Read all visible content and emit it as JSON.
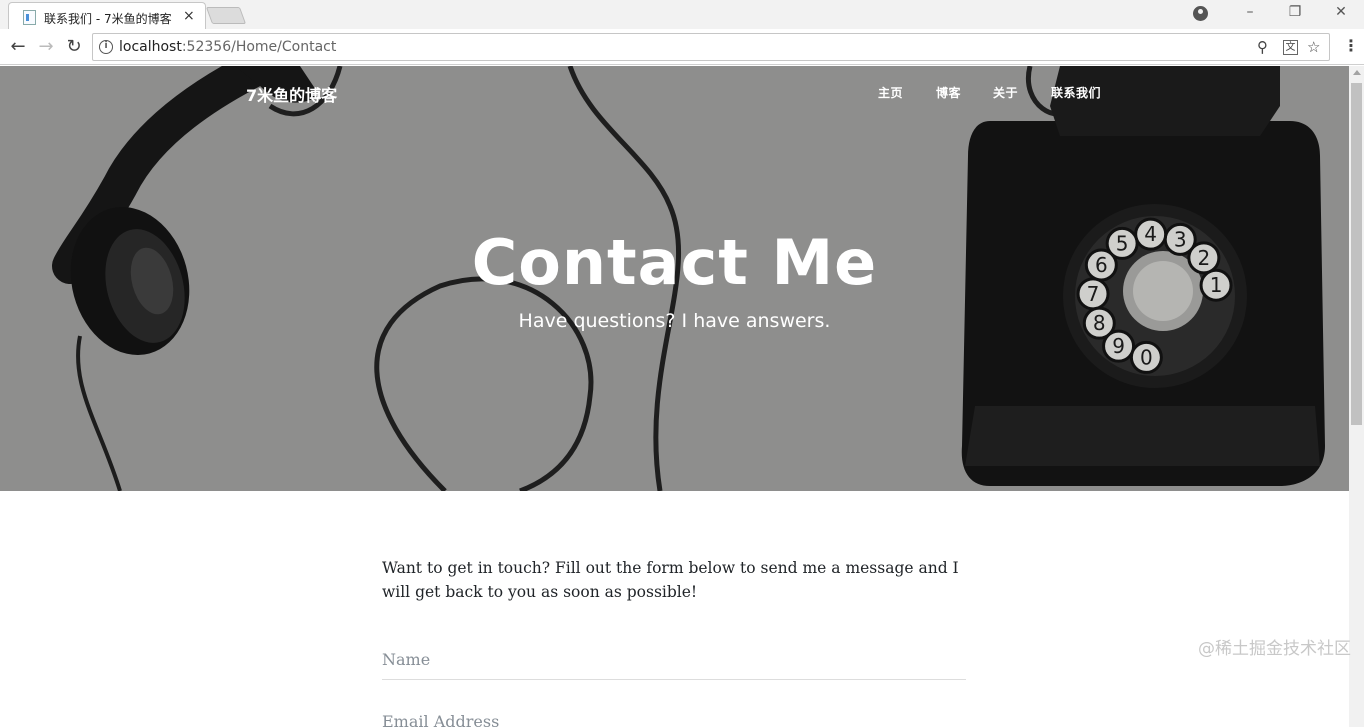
{
  "browser": {
    "tab_title": "联系我们 - 7米鱼的博客",
    "tab_close": "×",
    "url_host": "localhost",
    "url_rest": ":52356/Home/Contact"
  },
  "site": {
    "brand": "7米鱼的博客",
    "nav": [
      "主页",
      "博客",
      "关于",
      "联系我们"
    ]
  },
  "hero": {
    "title": "Contact Me",
    "subtitle": "Have questions? I have answers."
  },
  "form": {
    "intro": "Want to get in touch? Fill out the form below to send me a message and I will get back to you as soon as possible!",
    "name_placeholder": "Name",
    "email_placeholder": "Email Address"
  },
  "watermark": "@稀土掘金技术社区",
  "dial_numbers": [
    "1",
    "2",
    "3",
    "4",
    "5",
    "6",
    "7",
    "8",
    "9",
    "0"
  ]
}
